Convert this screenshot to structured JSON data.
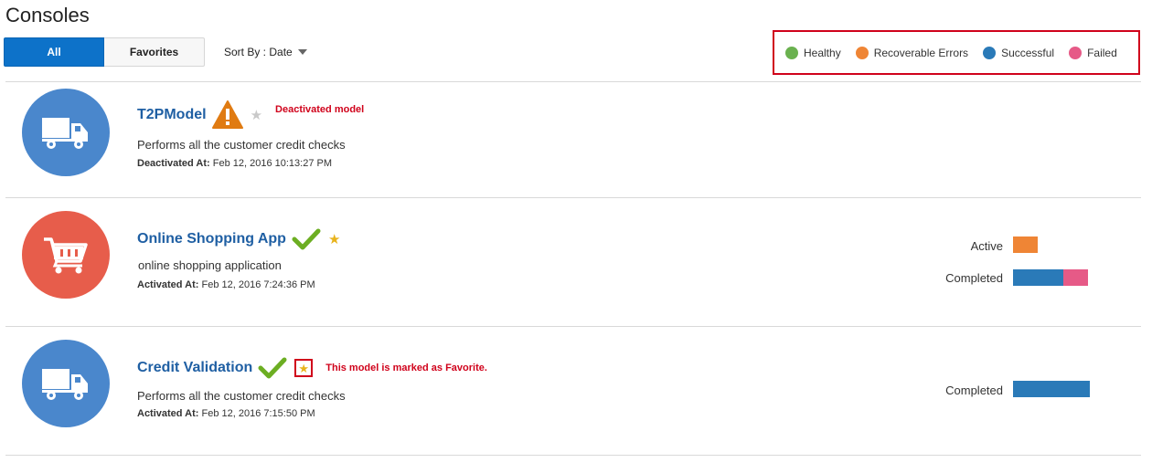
{
  "page": {
    "title": "Consoles"
  },
  "tabs": [
    {
      "label": "All",
      "active": true
    },
    {
      "label": "Favorites",
      "active": false
    }
  ],
  "sort": {
    "label": "Sort By : Date"
  },
  "legend": [
    {
      "label": "Healthy",
      "color": "#6ab14f"
    },
    {
      "label": "Recoverable Errors",
      "color": "#ef8535"
    },
    {
      "label": "Successful",
      "color": "#2a7ab8"
    },
    {
      "label": "Failed",
      "color": "#e65a87"
    }
  ],
  "models": [
    {
      "name": "T2PModel",
      "icon": "truck-icon",
      "icon_bg": "#4a87cc",
      "status_icon": "warning-icon",
      "favorite": false,
      "annotation": "Deactivated model",
      "description": "Performs all the customer credit checks",
      "meta_label": "Deactivated At:",
      "meta_value": "Feb 12, 2016 10:13:27 PM",
      "stats": []
    },
    {
      "name": "Online Shopping App",
      "icon": "cart-icon",
      "icon_bg": "#e75d4b",
      "status_icon": "checkmark-icon",
      "favorite": true,
      "annotation": "",
      "description": "online shopping application",
      "meta_label": "Activated At:",
      "meta_value": "Feb 12, 2016 7:24:36 PM",
      "stats": [
        {
          "label": "Active",
          "segments": [
            {
              "value": 1,
              "color": "#ef8535"
            }
          ]
        },
        {
          "label": "Completed",
          "segments": [
            {
              "value": 2,
              "color": "#2a7ab8"
            },
            {
              "value": 1,
              "color": "#e65a87"
            }
          ]
        }
      ]
    },
    {
      "name": "Credit Validation",
      "icon": "truck-icon",
      "icon_bg": "#4a87cc",
      "status_icon": "checkmark-icon",
      "favorite": true,
      "annotation": "This model is marked as Favorite.",
      "description": "Performs all the customer credit checks",
      "meta_label": "Activated At:",
      "meta_value": "Feb 12, 2016 7:15:50 PM",
      "stats": [
        {
          "label": "Completed",
          "segments": [
            {
              "value": 3,
              "color": "#2a7ab8"
            }
          ]
        }
      ]
    }
  ]
}
